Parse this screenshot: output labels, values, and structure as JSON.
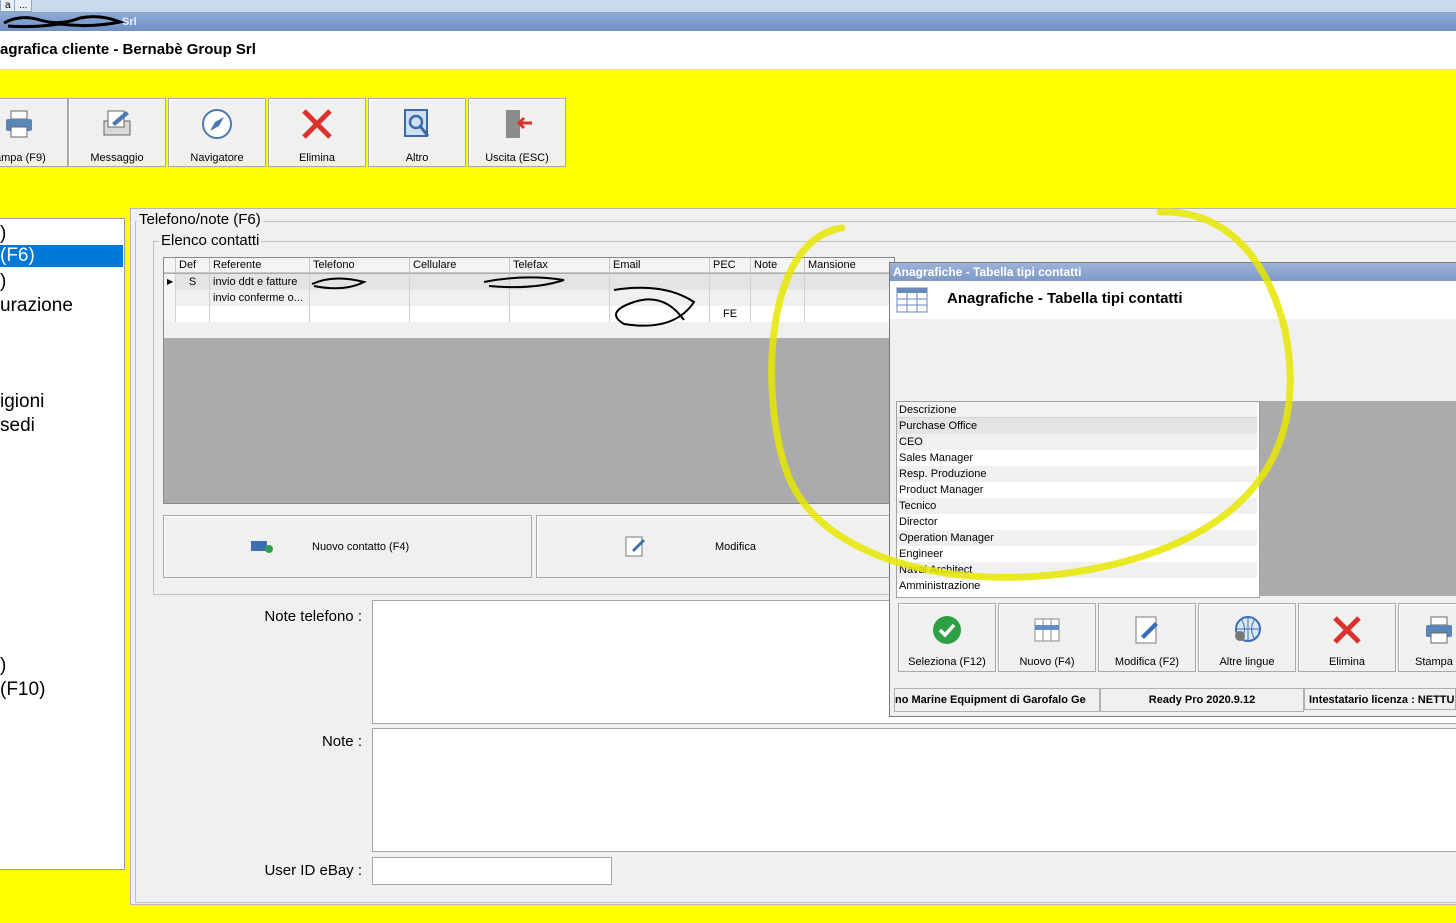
{
  "tabs": {
    "t1": "a",
    "t2": "..."
  },
  "window_title": "Srl",
  "header_title": "agrafica cliente - Bernabè Group Srl",
  "toolbar": [
    "ampa (F9)",
    "Messaggio",
    "Navigatore",
    "Elimina",
    "Altro",
    "Uscita (ESC)"
  ],
  "left_nav": [
    ")",
    " (F6)",
    ")",
    "urazione",
    "igioni",
    " sedi",
    ")",
    " (F10)"
  ],
  "group_phone": "Telefono/note (F6)",
  "group_contacts": "Elenco contatti",
  "grid": {
    "columns": [
      "Def",
      "Referente",
      "Telefono",
      "Cellulare",
      "Telefax",
      "Email",
      "PEC",
      "Note",
      "Mansione"
    ],
    "rows": [
      {
        "def": "S",
        "referente": "invio ddt e fatture",
        "pec": ""
      },
      {
        "def": "",
        "referente": "invio conferme o...",
        "pec": ""
      },
      {
        "def": "",
        "referente": "",
        "pec": "FE"
      }
    ]
  },
  "buttons": {
    "new_contact": "Nuovo contatto (F4)",
    "modify": "Modifica"
  },
  "fields": {
    "note_phone": "Note telefono :",
    "note": "Note :",
    "ebay": "User ID eBay :"
  },
  "dialog": {
    "title": "Anagrafiche - Tabella tipi contatti",
    "header": "Anagrafiche - Tabella tipi contatti",
    "list_header": "Descrizione",
    "items": [
      "Purchase Office",
      "CEO",
      "Sales Manager",
      "Resp. Produzione",
      "Product Manager",
      "Tecnico",
      "Director",
      "Operation Manager",
      "Engineer",
      "Naval Architect",
      "Amministrazione"
    ],
    "buttons": [
      "Seleziona (F12)",
      "Nuovo (F4)",
      "Modifica (F2)",
      "Altre lingue",
      "Elimina",
      "Stampa"
    ],
    "status": [
      "no Marine Equipment di Garofalo Ge",
      "Ready Pro 2020.9.12",
      "Intestatario licenza : NETTU"
    ]
  },
  "colors": {
    "background": "#ffff00",
    "selected": "#0078d7",
    "delete": "#d9342b",
    "select_ok": "#2ea043"
  }
}
